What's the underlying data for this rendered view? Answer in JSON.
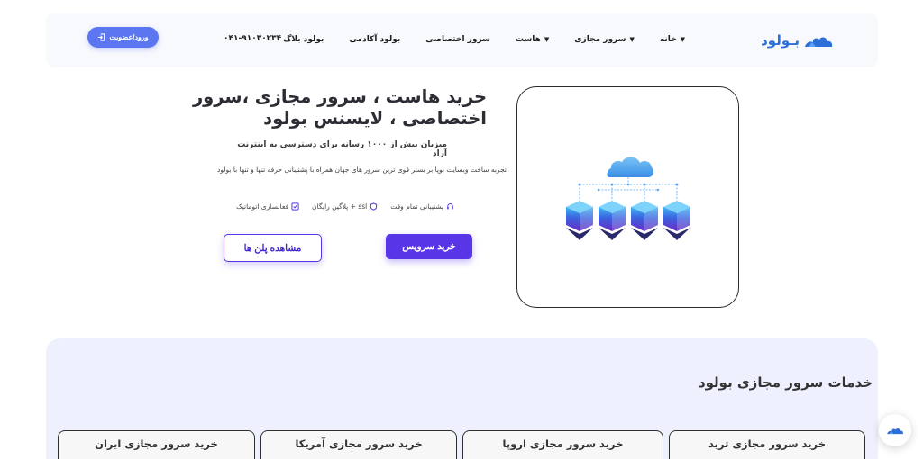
{
  "header": {
    "logo_text": "بـولود",
    "nav": [
      {
        "label": "خانه",
        "has_dropdown": true
      },
      {
        "label": "سرور مجازی",
        "has_dropdown": true
      },
      {
        "label": "هاست",
        "has_dropdown": true
      },
      {
        "label": "سرور اختصاصی",
        "has_dropdown": false
      },
      {
        "label": "بولود آکادمی",
        "has_dropdown": false
      },
      {
        "label": "بولود بلاگ",
        "has_dropdown": false
      }
    ],
    "phone": "۰۴۱-۹۱۰۳۰۲۳۴",
    "login_label": "ورود/عضویت"
  },
  "hero": {
    "title_line1": "خرید هاست ، سرور مجازی ،سرور",
    "title_line2": "اختصاصی ، لایسنس بولود",
    "subtitle": "میزبان بیش از ۱۰۰۰ رسانه برای دسترسی به اینترنت آزاد",
    "description": "تجربه ساخت وبسایت نوپا بر بستر قوی ترین سرور های جهان همراه با پشتیبانی حرفه تنها و تنها با بولود",
    "features": [
      {
        "label": "فعالسازی اتوماتیک",
        "icon": "checkbox-icon"
      },
      {
        "label": "ssl + پلاگین رایگان",
        "icon": "shield-icon"
      },
      {
        "label": "پشتیبانی تمام وقت",
        "icon": "headset-icon"
      }
    ],
    "primary_button": "خرید سرویس",
    "secondary_button": "مشاهده پلن ها"
  },
  "services": {
    "title": "خدمات سرور مجازی بولود",
    "cards": [
      "خرید سرور مجازی ترید",
      "خرید سرور مجازی اروپا",
      "خرید سرور مجازی آمریکا",
      "خرید سرور مجازی ایران"
    ]
  },
  "colors": {
    "primary": "#5835e6",
    "login": "#5b76f0",
    "brand": "#2d6fd8"
  }
}
